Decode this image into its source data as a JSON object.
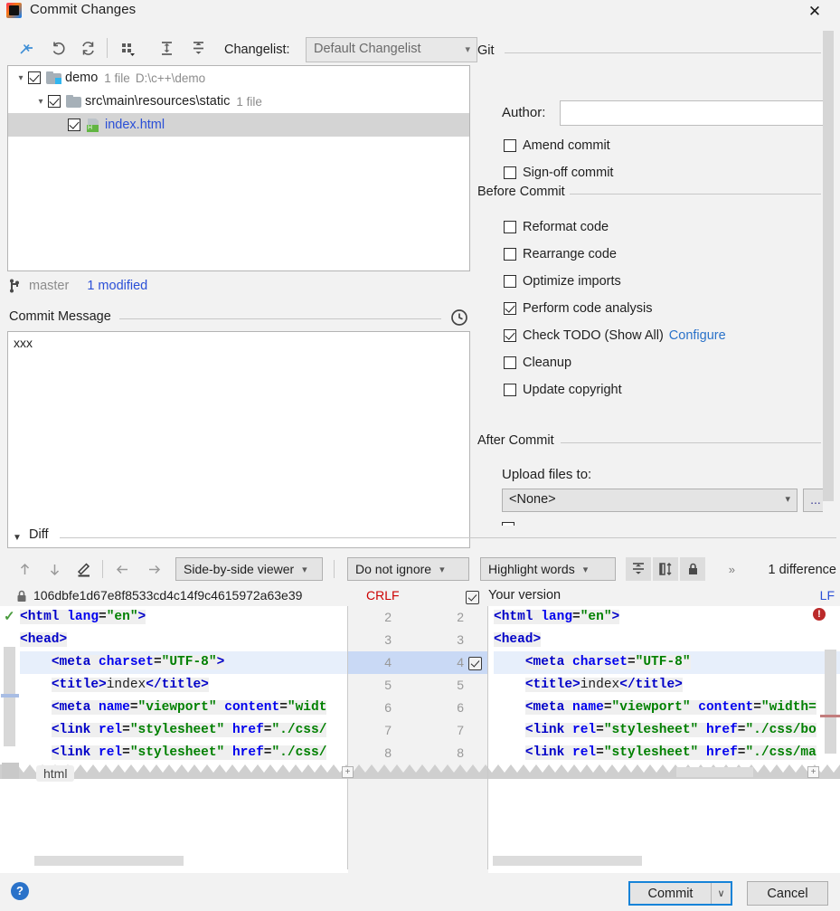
{
  "window": {
    "title": "Commit Changes",
    "app_icon": "intellij-idea-icon",
    "close_label": "✕"
  },
  "toolbar": {
    "icons": [
      {
        "name": "show-diff-icon",
        "tip": "Show Diff"
      },
      {
        "name": "revert-icon",
        "tip": "Revert"
      },
      {
        "name": "refresh-icon",
        "tip": "Refresh Changes"
      },
      {
        "name": "group-by-icon",
        "tip": "Group By"
      },
      {
        "name": "expand-all-icon",
        "tip": "Expand All"
      },
      {
        "name": "collapse-all-icon",
        "tip": "Collapse All"
      }
    ],
    "changelist_label": "Changelist:",
    "changelist_value": "Default Changelist"
  },
  "tree": {
    "rows": [
      {
        "name": "demo",
        "meta1": "1 file",
        "meta2": "D:\\c++\\demo",
        "checked": true,
        "selected": false,
        "icon": "folder-modified-icon",
        "link": false
      },
      {
        "name": "src\\main\\resources\\static",
        "meta1": "1 file",
        "meta2": "",
        "checked": true,
        "selected": false,
        "icon": "folder-icon",
        "link": false
      },
      {
        "name": "index.html",
        "meta1": "",
        "meta2": "",
        "checked": true,
        "selected": true,
        "icon": "html-file-icon",
        "link": true
      }
    ]
  },
  "branch": {
    "icon": "git-branch-icon",
    "name": "master",
    "modified": "1 modified"
  },
  "commit_message": {
    "title": "Commit Message",
    "history_icon": "clock-history-icon",
    "value": "xxx",
    "placeholder": ""
  },
  "git_panel": {
    "group_title": "Git",
    "author_label": "Author:",
    "author_value": "",
    "author_placeholder": "",
    "options": [
      {
        "label": "Amend commit",
        "checked": false,
        "name": "amend-commit"
      },
      {
        "label": "Sign-off commit",
        "checked": false,
        "name": "sign-off-commit"
      }
    ]
  },
  "before_commit": {
    "group_title": "Before Commit",
    "options": [
      {
        "label": "Reformat code",
        "checked": false,
        "name": "reformat-code"
      },
      {
        "label": "Rearrange code",
        "checked": false,
        "name": "rearrange-code"
      },
      {
        "label": "Optimize imports",
        "checked": false,
        "name": "optimize-imports"
      },
      {
        "label": "Perform code analysis",
        "checked": true,
        "name": "perform-code-analysis"
      },
      {
        "label": "Check TODO (Show All)",
        "checked": true,
        "name": "check-todo",
        "link": "Configure"
      },
      {
        "label": "Cleanup",
        "checked": false,
        "name": "cleanup"
      },
      {
        "label": "Update copyright",
        "checked": false,
        "name": "update-copyright"
      }
    ]
  },
  "after_commit": {
    "group_title": "After Commit",
    "upload_label": "Upload files to:",
    "upload_value": "<None>",
    "browse_label": "..."
  },
  "diff": {
    "section_label": "Diff",
    "toolbar_icons": [
      {
        "name": "previous-difference-icon"
      },
      {
        "name": "next-difference-icon"
      },
      {
        "name": "edit-source-icon"
      },
      {
        "name": "apply-left-icon"
      },
      {
        "name": "apply-right-icon"
      },
      {
        "name": "collapse-unchanged-icon"
      },
      {
        "name": "toggle-columns-icon"
      },
      {
        "name": "lock-icon"
      }
    ],
    "viewer_mode": "Side-by-side viewer",
    "ignore_mode": "Do not ignore",
    "highlight_mode": "Highlight words",
    "expand_chevrons": "»",
    "difference_count": "1 difference",
    "left_title": {
      "lock_icon": "lock-icon",
      "revision": "106dbfe1d67e8f8533cd4c14f9c4615972a63e39",
      "line_separator": "CRLF"
    },
    "right_title": {
      "checked": true,
      "label": "Your version",
      "line_separator": "LF"
    },
    "line_numbers": [
      {
        "left": "2",
        "right": "2",
        "highlight": false,
        "accept": false
      },
      {
        "left": "3",
        "right": "3",
        "highlight": false,
        "accept": false
      },
      {
        "left": "4",
        "right": "4",
        "highlight": true,
        "accept": true
      },
      {
        "left": "5",
        "right": "5",
        "highlight": false,
        "accept": false
      },
      {
        "left": "6",
        "right": "6",
        "highlight": false,
        "accept": false
      },
      {
        "left": "7",
        "right": "7",
        "highlight": false,
        "accept": false
      },
      {
        "left": "8",
        "right": "8",
        "highlight": false,
        "accept": false
      }
    ],
    "left_code": [
      "<html lang=\"en\">",
      "<head>",
      "    <meta charset=\"UTF-8\">",
      "    <title>index</title>",
      "    <meta name=\"viewport\" content=\"widt",
      "    <link rel=\"stylesheet\" href=\"./css/",
      "    <link rel=\"stylesheet\" href=\"./css/"
    ],
    "right_code": [
      "<html lang=\"en\">",
      "<head>",
      "    <meta charset=\"UTF-8\"",
      "    <title>index</title>",
      "    <meta name=\"viewport\" content=\"width=",
      "    <link rel=\"stylesheet\" href=\"./css/bo",
      "    <link rel=\"stylesheet\" href=\"./css/ma"
    ],
    "breadcrumb": "html",
    "left_status_icon": "ok-check-icon",
    "right_status_icon": "error-icon"
  },
  "footer": {
    "help_label": "?",
    "commit_label": "Commit",
    "commit_dropdown": "∨",
    "cancel_label": "Cancel"
  },
  "colors": {
    "accent": "#1683d8",
    "link": "#2a72c9",
    "tree_link": "#2a4fd7",
    "error": "#cc0000",
    "ok": "#4a9c3e",
    "selection": "#d4d4d4"
  }
}
